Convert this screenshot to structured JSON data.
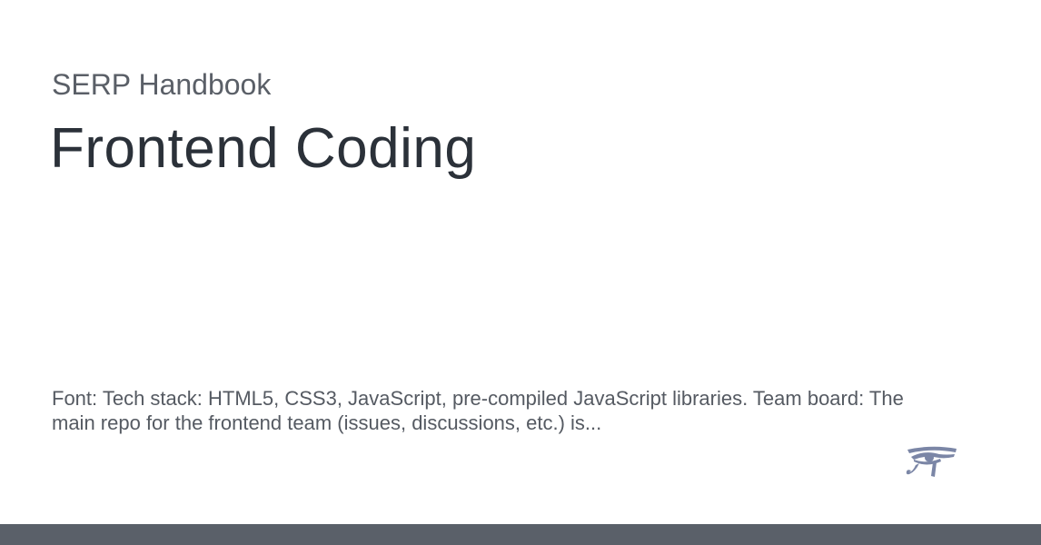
{
  "header": {
    "site_name": "SERP Handbook",
    "title": "Frontend Coding"
  },
  "description": "Font: Tech stack: HTML5, CSS3, JavaScript, pre-compiled JavaScript libraries. Team board: The main repo for the frontend team (issues, discussions, etc.) is...",
  "logo": {
    "icon": "eye-of-horus-icon"
  },
  "colors": {
    "logo": "#7b86a6",
    "footer_bar": "#5a6069"
  }
}
